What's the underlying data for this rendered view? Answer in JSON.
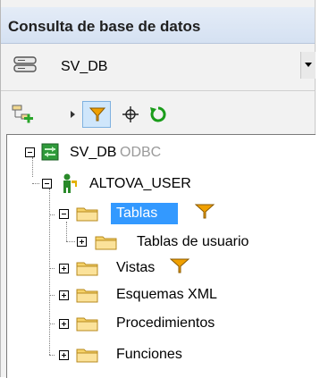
{
  "window": {
    "title": "Consulta de base de datos"
  },
  "datasource": {
    "selected": "SV_DB"
  },
  "toolbar": {
    "icons": [
      "add-connection-icon",
      "filter-icon",
      "locate-icon",
      "refresh-icon"
    ],
    "filter_active": true
  },
  "tree": {
    "root": {
      "label": "SV_DB",
      "tag": "ODBC"
    },
    "user": {
      "label": "ALTOVA_USER"
    },
    "items": [
      {
        "label": "Tablas",
        "selected": true,
        "filtered": true
      },
      {
        "label": "Tablas de usuario"
      },
      {
        "label": "Vistas",
        "filtered": true
      },
      {
        "label": "Esquemas XML"
      },
      {
        "label": "Procedimientos"
      },
      {
        "label": "Funciones"
      }
    ]
  },
  "colors": {
    "selection": "#3399ff",
    "filter": "#f0a000",
    "refresh": "#1a9c1a"
  }
}
